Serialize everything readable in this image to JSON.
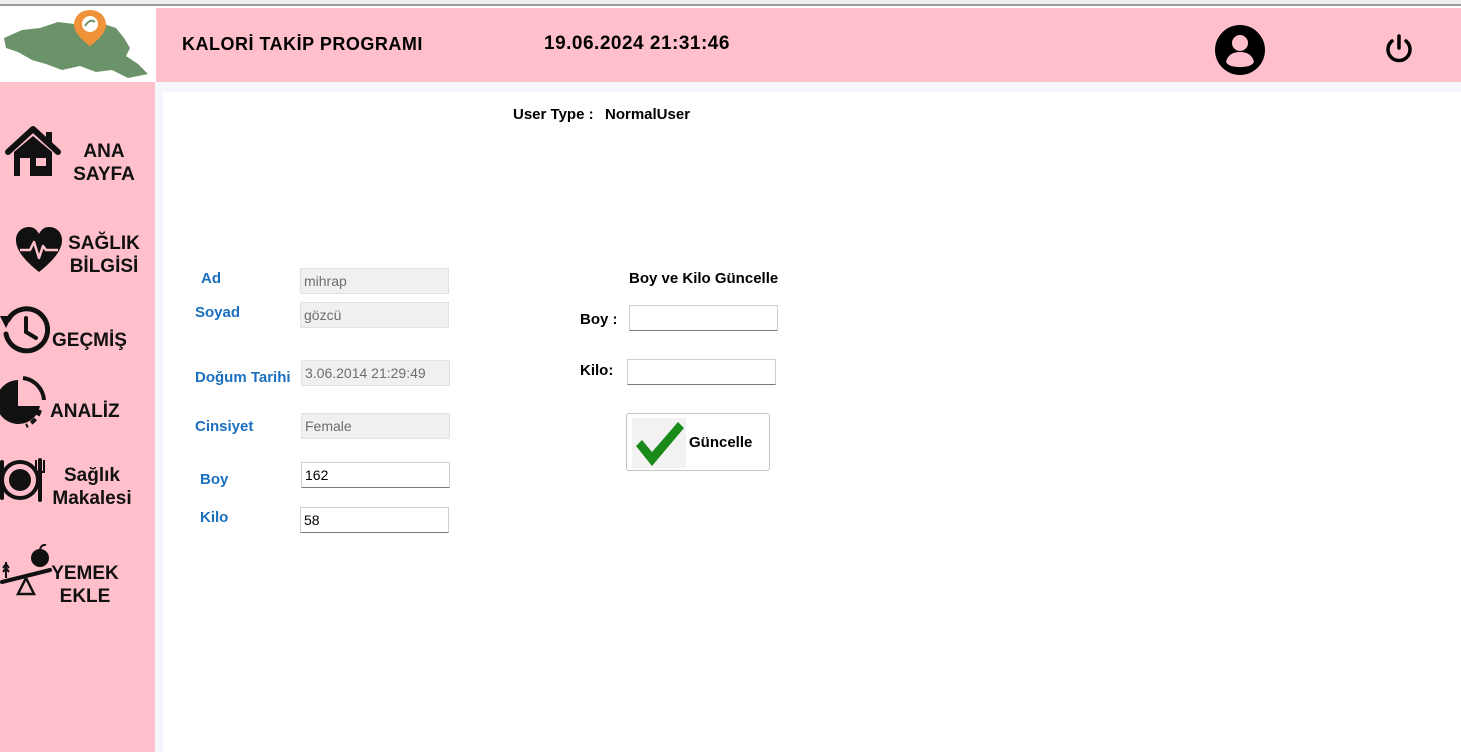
{
  "header": {
    "app_title": "KALORİ TAKİP PROGRAMI",
    "datetime": "19.06.2024 21:31:46",
    "brand_color": "#ffc0cb"
  },
  "icons": {
    "logo": "map-pin-logo-icon",
    "user": "user-circle-icon",
    "power": "power-icon"
  },
  "sidebar": {
    "items": [
      {
        "label_line1": "ANA",
        "label_line2": "SAYFA",
        "icon": "home-icon"
      },
      {
        "label_line1": "SAĞLIK",
        "label_line2": "BİLGİSİ",
        "icon": "heart-pulse-icon"
      },
      {
        "label_line1": "GEÇMİŞ",
        "icon": "history-icon"
      },
      {
        "label_line1": "ANALİZ",
        "icon": "pie-chart-icon"
      },
      {
        "label_line1": "Sağlık",
        "label_line2": "Makalesi",
        "icon": "plate-icon"
      },
      {
        "label_line1": "YEMEK",
        "label_line2": "EKLE",
        "icon": "seesaw-scale-icon"
      }
    ]
  },
  "user_type": {
    "label": "User Type :",
    "value": "NormalUser"
  },
  "profile": {
    "ad_label": "Ad",
    "ad_value": "mihrap",
    "soyad_label": "Soyad",
    "soyad_value": "gözcü",
    "dogum_label": "Doğum Tarihi",
    "dogum_value": "3.06.2014 21:29:49",
    "cinsiyet_label": "Cinsiyet",
    "cinsiyet_value": "Female",
    "boy_label": "Boy",
    "boy_value": "162",
    "kilo_label": "Kilo",
    "kilo_value": "58",
    "label_color": "#1a6fbf"
  },
  "update": {
    "title": "Boy ve Kilo Güncelle",
    "boy_label": "Boy :",
    "boy_value": "",
    "kilo_label": "Kilo:",
    "kilo_value": "",
    "button_label": "Güncelle",
    "button_icon": "checkmark-icon"
  }
}
